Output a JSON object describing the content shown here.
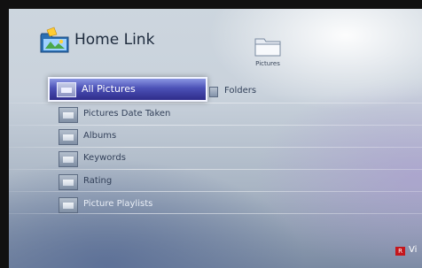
{
  "app": {
    "title": "Home Link"
  },
  "header": {
    "folder_label": "Pictures"
  },
  "selected_item": {
    "label": "All Pictures"
  },
  "tab": {
    "label": "Folders"
  },
  "menu": [
    {
      "label": "Pictures Date Taken"
    },
    {
      "label": "Albums"
    },
    {
      "label": "Keywords"
    },
    {
      "label": "Rating"
    },
    {
      "label": "Picture Playlists"
    }
  ],
  "footer": {
    "red_button_key": "R",
    "red_button_label": "Vi"
  },
  "colors": {
    "selection": "#4b50b6",
    "red_key": "#c4161c"
  }
}
